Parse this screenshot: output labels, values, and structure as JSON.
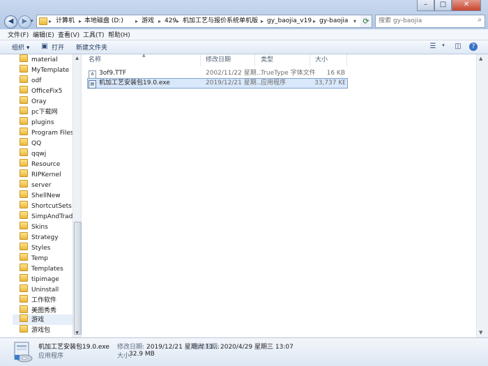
{
  "window": {
    "controls": {
      "minimize": "–",
      "maximize": "□",
      "close": "✕"
    }
  },
  "address": {
    "back_icon": "back-arrow-icon",
    "forward_icon": "forward-arrow-icon",
    "crumbs": [
      "计算机",
      "本地磁盘 (D:)",
      "游戏",
      "429",
      "机加工艺与报价系统单机版",
      "gy_baojia_v19",
      "gy-baojia"
    ],
    "search_placeholder": "搜索 gy-baojia"
  },
  "menu": [
    "文件(F)",
    "编辑(E)",
    "查看(V)",
    "工具(T)",
    "帮助(H)"
  ],
  "toolbar": {
    "organize": "组织 ▾",
    "open": "打开",
    "new_folder": "新建文件夹"
  },
  "nav": {
    "items": [
      "material",
      "MyTemplate",
      "odf",
      "OfficeFix5",
      "Oray",
      "pc下载网",
      "plugins",
      "Program Files",
      "QQ",
      "qqwj",
      "Resource",
      "RIPKernel",
      "server",
      "ShellNew",
      "ShortcutSets",
      "SimpAndTradCo",
      "Skins",
      "Strategy",
      "Styles",
      "Temp",
      "Templates",
      "tipimage",
      "Uninstall",
      "工作软件",
      "美图秀秀",
      "游戏",
      "游戏包"
    ],
    "selected_index": 25
  },
  "files": {
    "columns": {
      "name": "名称",
      "date": "修改日期",
      "type": "类型",
      "size": "大小"
    },
    "rows": [
      {
        "name": "3of9.TTF",
        "date": "2002/11/22 星期...",
        "type": "TrueType 字体文件",
        "size": "16 KB",
        "selected": false
      },
      {
        "name": "机加工艺安装包19.0.exe",
        "date": "2019/12/21 星期...",
        "type": "应用程序",
        "size": "33,737 KB",
        "selected": true
      }
    ]
  },
  "details": {
    "filename": "机加工艺安装包19.0.exe",
    "modified_label": "修改日期:",
    "modified_value": "2019/12/21 星期六 11...",
    "created_label": "创建日期:",
    "created_value": "2020/4/29 星期三 13:07",
    "kind": "应用程序",
    "size_label": "大小:",
    "size_value": "32.9 MB"
  }
}
